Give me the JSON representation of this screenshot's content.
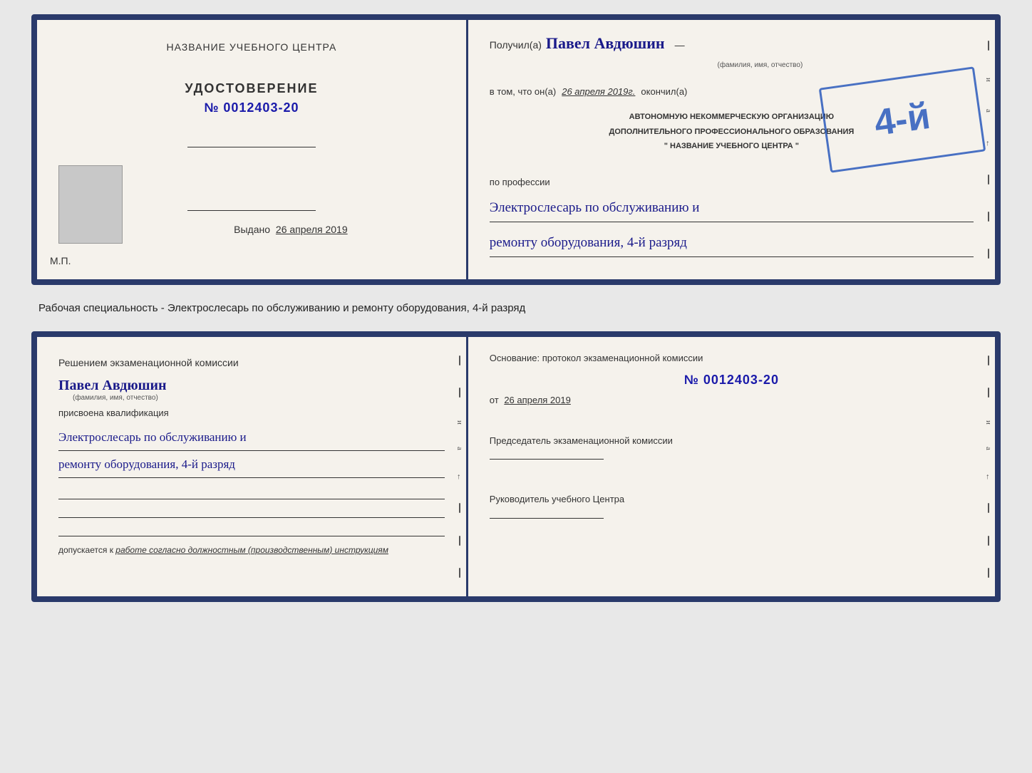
{
  "top_doc": {
    "left": {
      "training_center_label": "НАЗВАНИЕ УЧЕБНОГО ЦЕНТРА",
      "cert_type_label": "УДОСТОВЕРЕНИЕ",
      "cert_number": "№ 0012403-20",
      "issued_label": "Выдано",
      "issued_date": "26 апреля 2019",
      "mp_label": "М.П."
    },
    "right": {
      "received_prefix": "Получил(а)",
      "recipient_name": "Павел Авдюшин",
      "fio_hint": "(фамилия, имя, отчество)",
      "in_that_prefix": "в том, что он(а)",
      "date_value": "26 апреля 2019г.",
      "finished_label": "окончил(а)",
      "stamp_grade": "4-й",
      "stamp_line1": "АВТОНОМНУЮ НЕКОММЕРЧЕСКУЮ ОРГАНИЗАЦИЮ",
      "stamp_line2": "ДОПОЛНИТЕЛЬНОГО ПРОФЕССИОНАЛЬНОГО ОБРАЗОВАНИЯ",
      "stamp_line3": "\" НАЗВАНИЕ УЧЕБНОГО ЦЕНТРА \"",
      "profession_label": "по профессии",
      "profession_value": "Электрослесарь по обслуживанию и",
      "profession_value2": "ремонту оборудования, 4-й разряд"
    }
  },
  "middle": {
    "text": "Рабочая специальность - Электрослесарь по обслуживанию и ремонту оборудования, 4-й разряд"
  },
  "bottom_doc": {
    "left": {
      "commission_decision": "Решением экзаменационной комиссии",
      "person_name": "Павел Авдюшин",
      "fio_hint": "(фамилия, имя, отчество)",
      "assigned_label": "присвоена квалификация",
      "qualification1": "Электрослесарь по обслуживанию и",
      "qualification2": "ремонту оборудования, 4-й разряд",
      "allowed_prefix": "допускается к",
      "allowed_text": "работе согласно должностным (производственным) инструкциям"
    },
    "right": {
      "basis_label": "Основание: протокол экзаменационной комиссии",
      "number": "№ 0012403-20",
      "date_prefix": "от",
      "date_value": "26 апреля 2019",
      "chairman_label": "Председатель экзаменационной комиссии",
      "director_label": "Руководитель учебного Центра"
    }
  },
  "side_decorations": {
    "letters": [
      "и",
      "а",
      "←"
    ]
  }
}
